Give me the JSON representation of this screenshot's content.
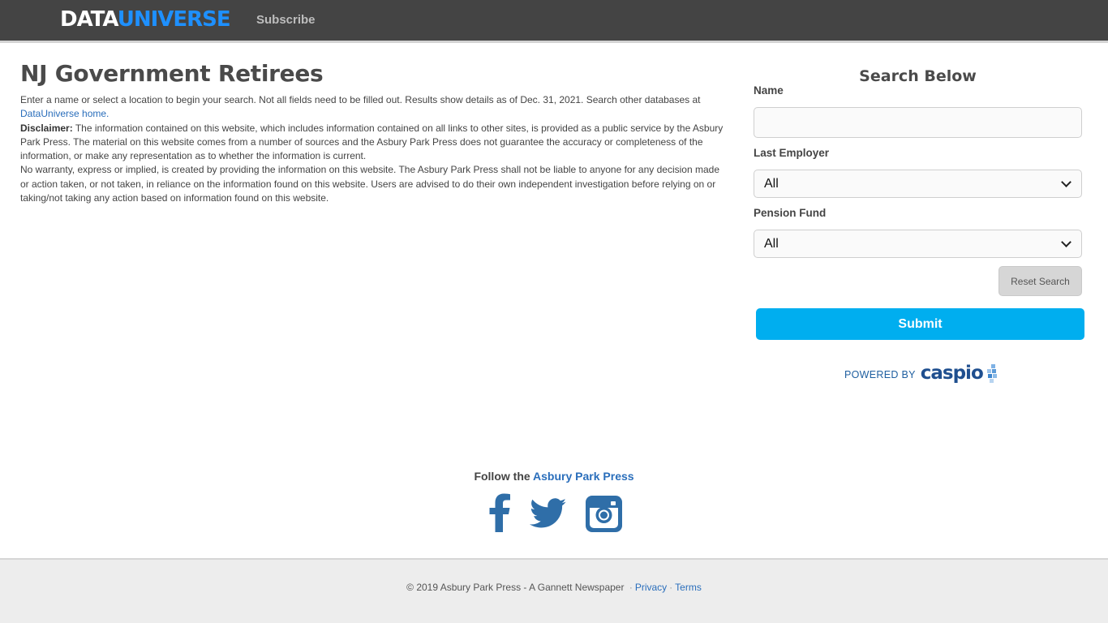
{
  "header": {
    "logo_part1": "DATA",
    "logo_part2": "UNIVERSE",
    "subscribe_label": "Subscribe"
  },
  "main": {
    "title": "NJ Government Retirees",
    "intro_text": "Enter a name or select a location to begin your search. Not all fields need to be filled out. Results show details as of Dec. 31, 2021. Search other databases at",
    "intro_link": "DataUniverse home.",
    "disclaimer_label": "Disclaimer:",
    "disclaimer_text": "The information contained on this website, which includes information contained on all links to other sites, is provided as a public service by the Asbury Park Press.  The material on this website comes from a number of sources and the Asbury Park Press does not guarantee the accuracy or completeness of the information, or make any representation as to whether the information is current.",
    "warranty_text": "No warranty, express or implied, is created by providing the information on this website. The Asbury Park Press shall not be liable to anyone for any decision made or action taken, or not taken, in reliance on the information found on this website.  Users are advised to do their own independent investigation before relying on or taking/not taking any action based on information found on this website."
  },
  "search": {
    "title": "Search Below",
    "name_label": "Name",
    "name_value": "",
    "employer_label": "Last Employer",
    "employer_selected": "All",
    "fund_label": "Pension Fund",
    "fund_selected": "All",
    "reset_label": "Reset Search",
    "submit_label": "Submit",
    "powered_by": "POWERED BY",
    "powered_brand": "caspio"
  },
  "follow": {
    "prefix": "Follow the",
    "link": "Asbury Park Press",
    "icons": [
      "facebook-icon",
      "twitter-icon",
      "instagram-icon"
    ]
  },
  "footer": {
    "copyright": "© 2019 Asbury Park Press - A Gannett Newspaper",
    "sep1": "·",
    "privacy": "Privacy",
    "sep2": "·",
    "terms": "Terms"
  },
  "colors": {
    "topbar": "#444444",
    "brand_blue": "#1e90ff",
    "submit": "#00aeef",
    "link": "#2a6ebb",
    "social": "#2f6ea8"
  }
}
